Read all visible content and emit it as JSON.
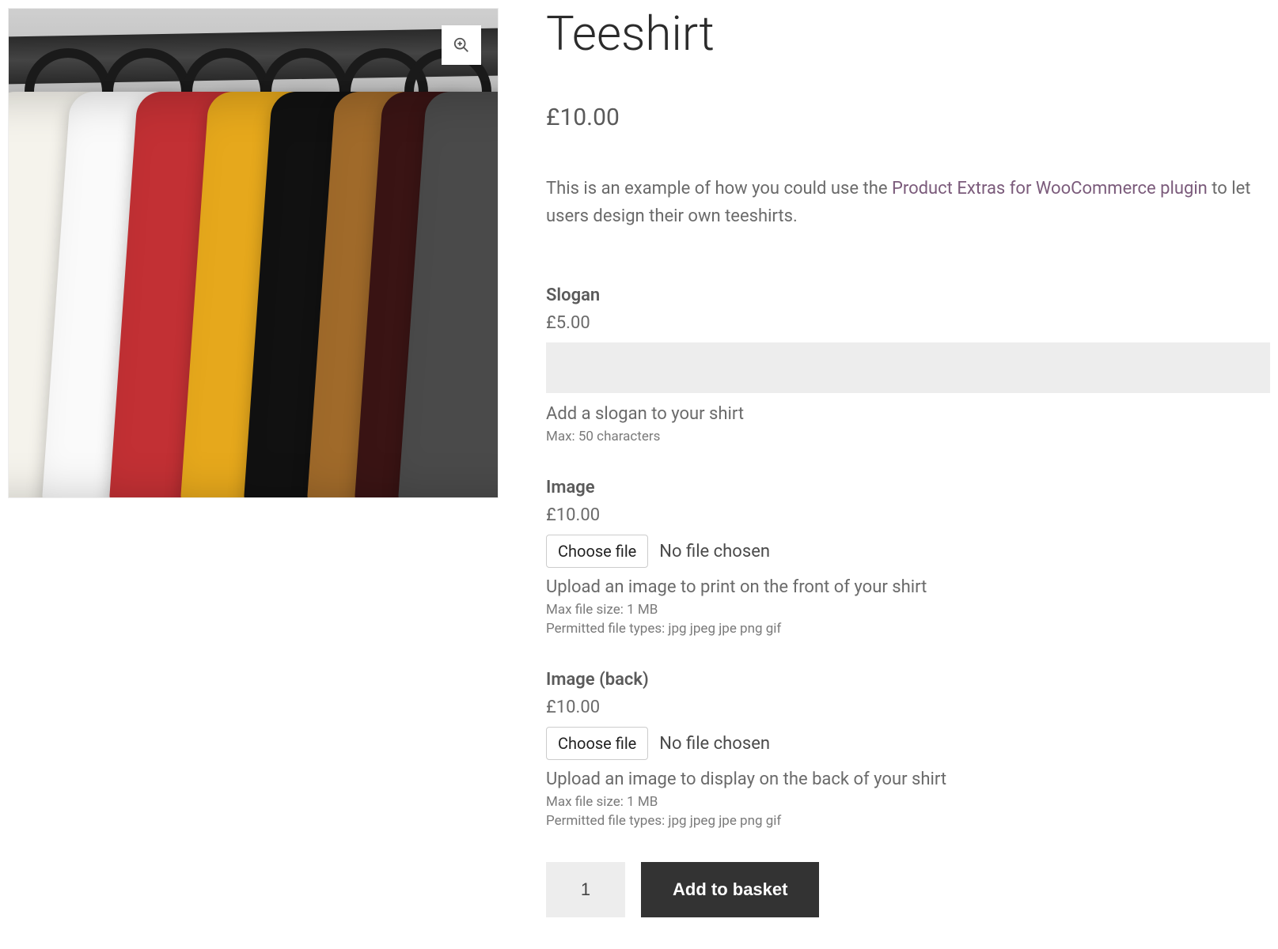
{
  "product": {
    "title": "Teeshirt",
    "price": "£10.00",
    "description_before": "This is an example of how you could use the ",
    "description_link": "Product Extras for WooCommerce plugin",
    "description_after": " to let users design their own teeshirts."
  },
  "zoom_icon_name": "zoom-in",
  "extras": {
    "slogan": {
      "label": "Slogan",
      "price": "£5.00",
      "help": "Add a slogan to your shirt",
      "max_note": "Max: 50 characters"
    },
    "image_front": {
      "label": "Image",
      "price": "£10.00",
      "choose_label": "Choose file",
      "file_status": "No file chosen",
      "help": "Upload an image to print on the front of your shirt",
      "size_note": "Max file size: 1 MB",
      "types_note": "Permitted file types: jpg jpeg jpe png gif"
    },
    "image_back": {
      "label": "Image (back)",
      "price": "£10.00",
      "choose_label": "Choose file",
      "file_status": "No file chosen",
      "help": "Upload an image to display on the back of your shirt",
      "size_note": "Max file size: 1 MB",
      "types_note": "Permitted file types: jpg jpeg jpe png gif"
    }
  },
  "cart": {
    "quantity": "1",
    "add_label": "Add to basket"
  }
}
